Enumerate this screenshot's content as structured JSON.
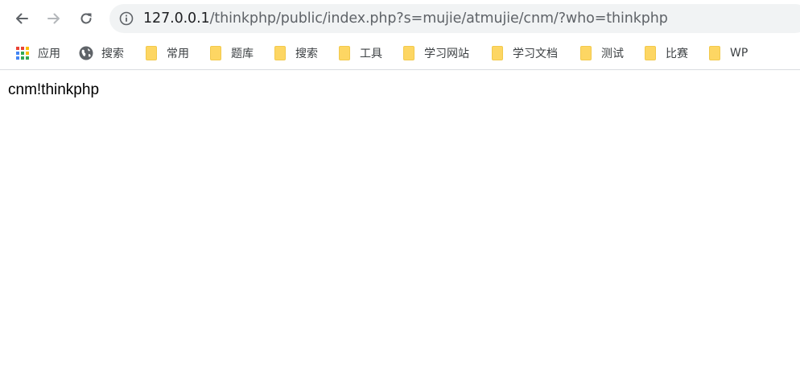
{
  "browser": {
    "url_host": "127.0.0.1",
    "url_path": "/thinkphp/public/index.php?s=mujie/atmujie/cnm/?who=thinkphp"
  },
  "bookmarks": [
    {
      "label": "应用",
      "icon": "apps-grid-icon"
    },
    {
      "label": "搜索",
      "icon": "globe-icon"
    },
    {
      "label": "常用",
      "icon": "folder-icon"
    },
    {
      "label": "题库",
      "icon": "folder-icon"
    },
    {
      "label": "搜索",
      "icon": "folder-icon"
    },
    {
      "label": "工具",
      "icon": "folder-icon"
    },
    {
      "label": "学习网站",
      "icon": "folder-icon"
    },
    {
      "label": "学习文档",
      "icon": "folder-icon"
    },
    {
      "label": "测试",
      "icon": "folder-icon"
    },
    {
      "label": "比赛",
      "icon": "folder-icon"
    },
    {
      "label": "WP",
      "icon": "folder-icon"
    }
  ],
  "page": {
    "body_text": "cnm!thinkphp"
  },
  "colors": {
    "omnibox_bg": "#f1f3f4",
    "folder_yellow": "#fdd663",
    "icon_gray": "#5f6368"
  }
}
